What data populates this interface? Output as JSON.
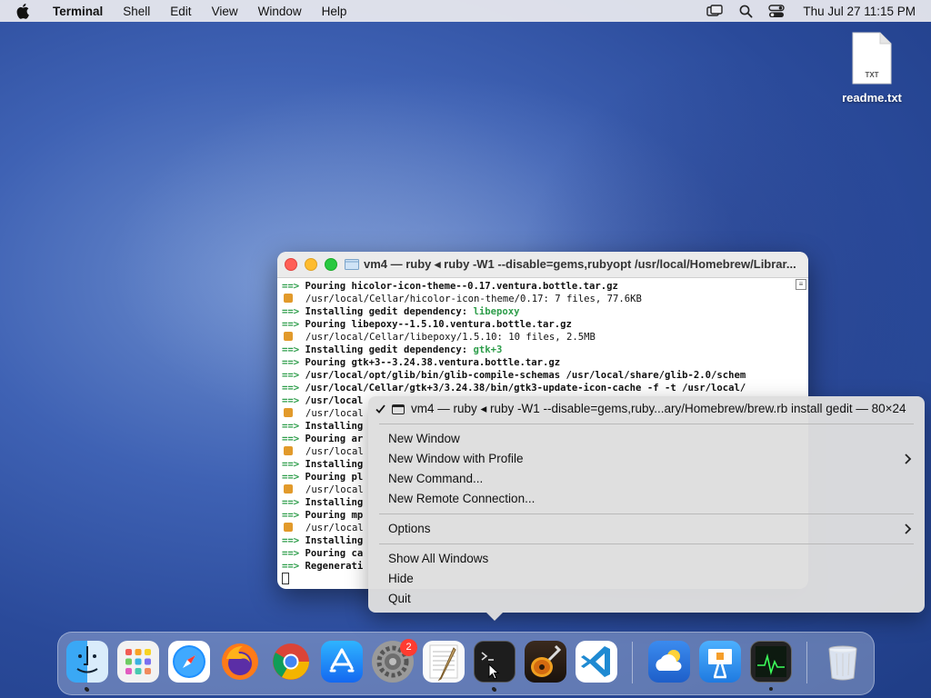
{
  "menubar": {
    "app_name": "Terminal",
    "items": [
      "Shell",
      "Edit",
      "View",
      "Window",
      "Help"
    ],
    "clock": "Thu Jul 27  11:15 PM"
  },
  "desktop": {
    "file_name": "readme.txt",
    "file_type": "TXT"
  },
  "terminal": {
    "title": "vm4 — ruby ◂ ruby -W1 --disable=gems,rubyopt /usr/local/Homebrew/Librar...",
    "arrow": "==>",
    "lines": [
      {
        "kind": "arrow",
        "text": "Pouring hicolor-icon-theme--0.17.ventura.bottle.tar.gz"
      },
      {
        "kind": "beer",
        "text": "/usr/local/Cellar/hicolor-icon-theme/0.17: 7 files, 77.6KB"
      },
      {
        "kind": "arrow",
        "text": "Installing gedit dependency: ",
        "hl": "libepoxy"
      },
      {
        "kind": "arrow",
        "text": "Pouring libepoxy--1.5.10.ventura.bottle.tar.gz"
      },
      {
        "kind": "beer",
        "text": "/usr/local/Cellar/libepoxy/1.5.10: 10 files, 2.5MB"
      },
      {
        "kind": "arrow",
        "text": "Installing gedit dependency: ",
        "hl": "gtk+3"
      },
      {
        "kind": "arrow",
        "text": "Pouring gtk+3--3.24.38.ventura.bottle.tar.gz"
      },
      {
        "kind": "arrow",
        "text": "/usr/local/opt/glib/bin/glib-compile-schemas /usr/local/share/glib-2.0/schem"
      },
      {
        "kind": "arrow",
        "text": "/usr/local/Cellar/gtk+3/3.24.38/bin/gtk3-update-icon-cache -f -t /usr/local/"
      },
      {
        "kind": "arrow",
        "text": "/usr/local"
      },
      {
        "kind": "beer",
        "text": "/usr/local"
      },
      {
        "kind": "arrow",
        "text": "Installing"
      },
      {
        "kind": "arrow",
        "text": "Pouring ar"
      },
      {
        "kind": "beer",
        "text": "/usr/local"
      },
      {
        "kind": "arrow",
        "text": "Installing"
      },
      {
        "kind": "arrow",
        "text": "Pouring pl"
      },
      {
        "kind": "beer",
        "text": "/usr/local"
      },
      {
        "kind": "arrow",
        "text": "Installing"
      },
      {
        "kind": "arrow",
        "text": "Pouring mp"
      },
      {
        "kind": "beer",
        "text": "/usr/local"
      },
      {
        "kind": "arrow",
        "text": "Installing"
      },
      {
        "kind": "arrow",
        "text": "Pouring ca"
      },
      {
        "kind": "arrow",
        "text": "Regenerati"
      },
      {
        "kind": "cursor",
        "text": ""
      }
    ]
  },
  "dock_menu": {
    "current_window": "vm4 — ruby ◂ ruby -W1 --disable=gems,ruby...ary/Homebrew/brew.rb install gedit — 80×24",
    "new_window": "New Window",
    "new_window_profile": "New Window with Profile",
    "new_command": "New Command...",
    "new_remote": "New Remote Connection...",
    "options": "Options",
    "show_all": "Show All Windows",
    "hide": "Hide",
    "quit": "Quit"
  },
  "dock": {
    "apps": [
      "finder",
      "launchpad",
      "safari",
      "firefox",
      "chrome",
      "app-store",
      "system-settings",
      "textedit",
      "terminal",
      "garageband",
      "vscode",
      "weather",
      "keynote",
      "activity-monitor",
      "trash"
    ],
    "settings_badge": "2"
  },
  "colors": {
    "accent_green": "#2d9d4a",
    "badge_red": "#ff3b30"
  }
}
